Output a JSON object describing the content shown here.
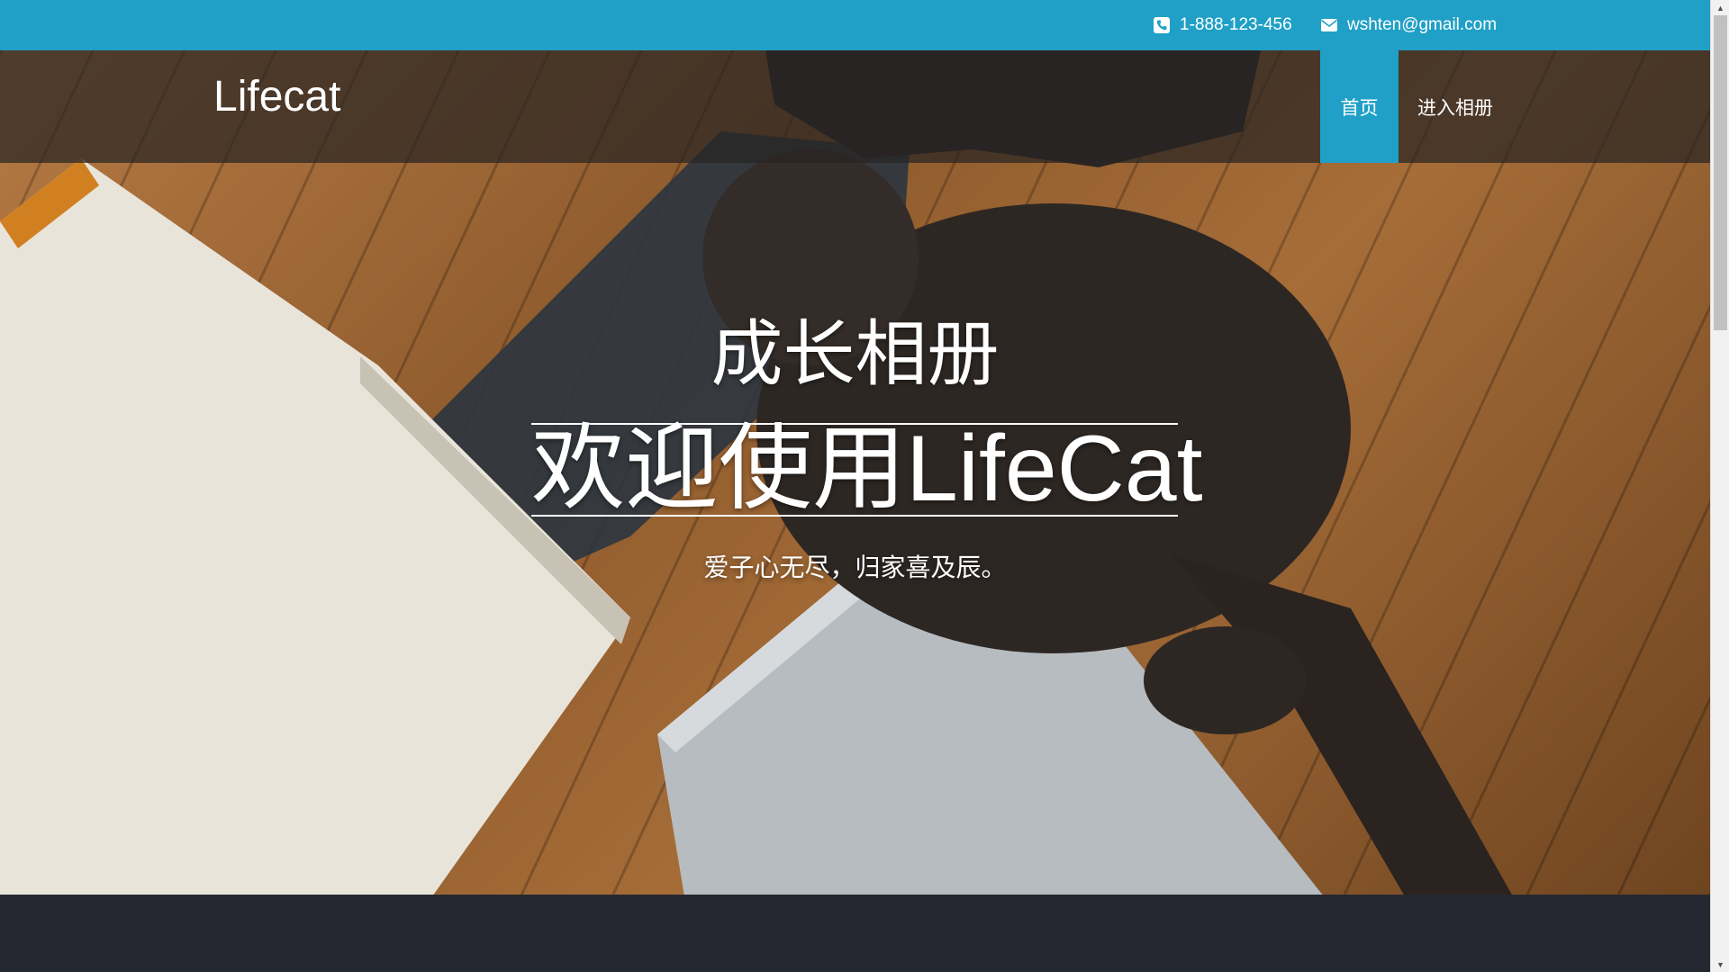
{
  "contact": {
    "phone": "1-888-123-456",
    "email": "wshten@gmail.com",
    "phone_icon": "phone-icon",
    "email_icon": "envelope-icon"
  },
  "navbar": {
    "brand": "Lifecat",
    "items": [
      {
        "label": "首页",
        "active": true
      },
      {
        "label": "进入相册",
        "active": false
      }
    ]
  },
  "hero": {
    "subtitle": "成长相册",
    "title": "欢迎使用LifeCat",
    "tagline": "爱子心无尽，归家喜及辰。"
  },
  "colors": {
    "accent": "#20a0c6",
    "footer": "#252830",
    "navbar_overlay": "rgba(40,36,34,0.72)"
  }
}
